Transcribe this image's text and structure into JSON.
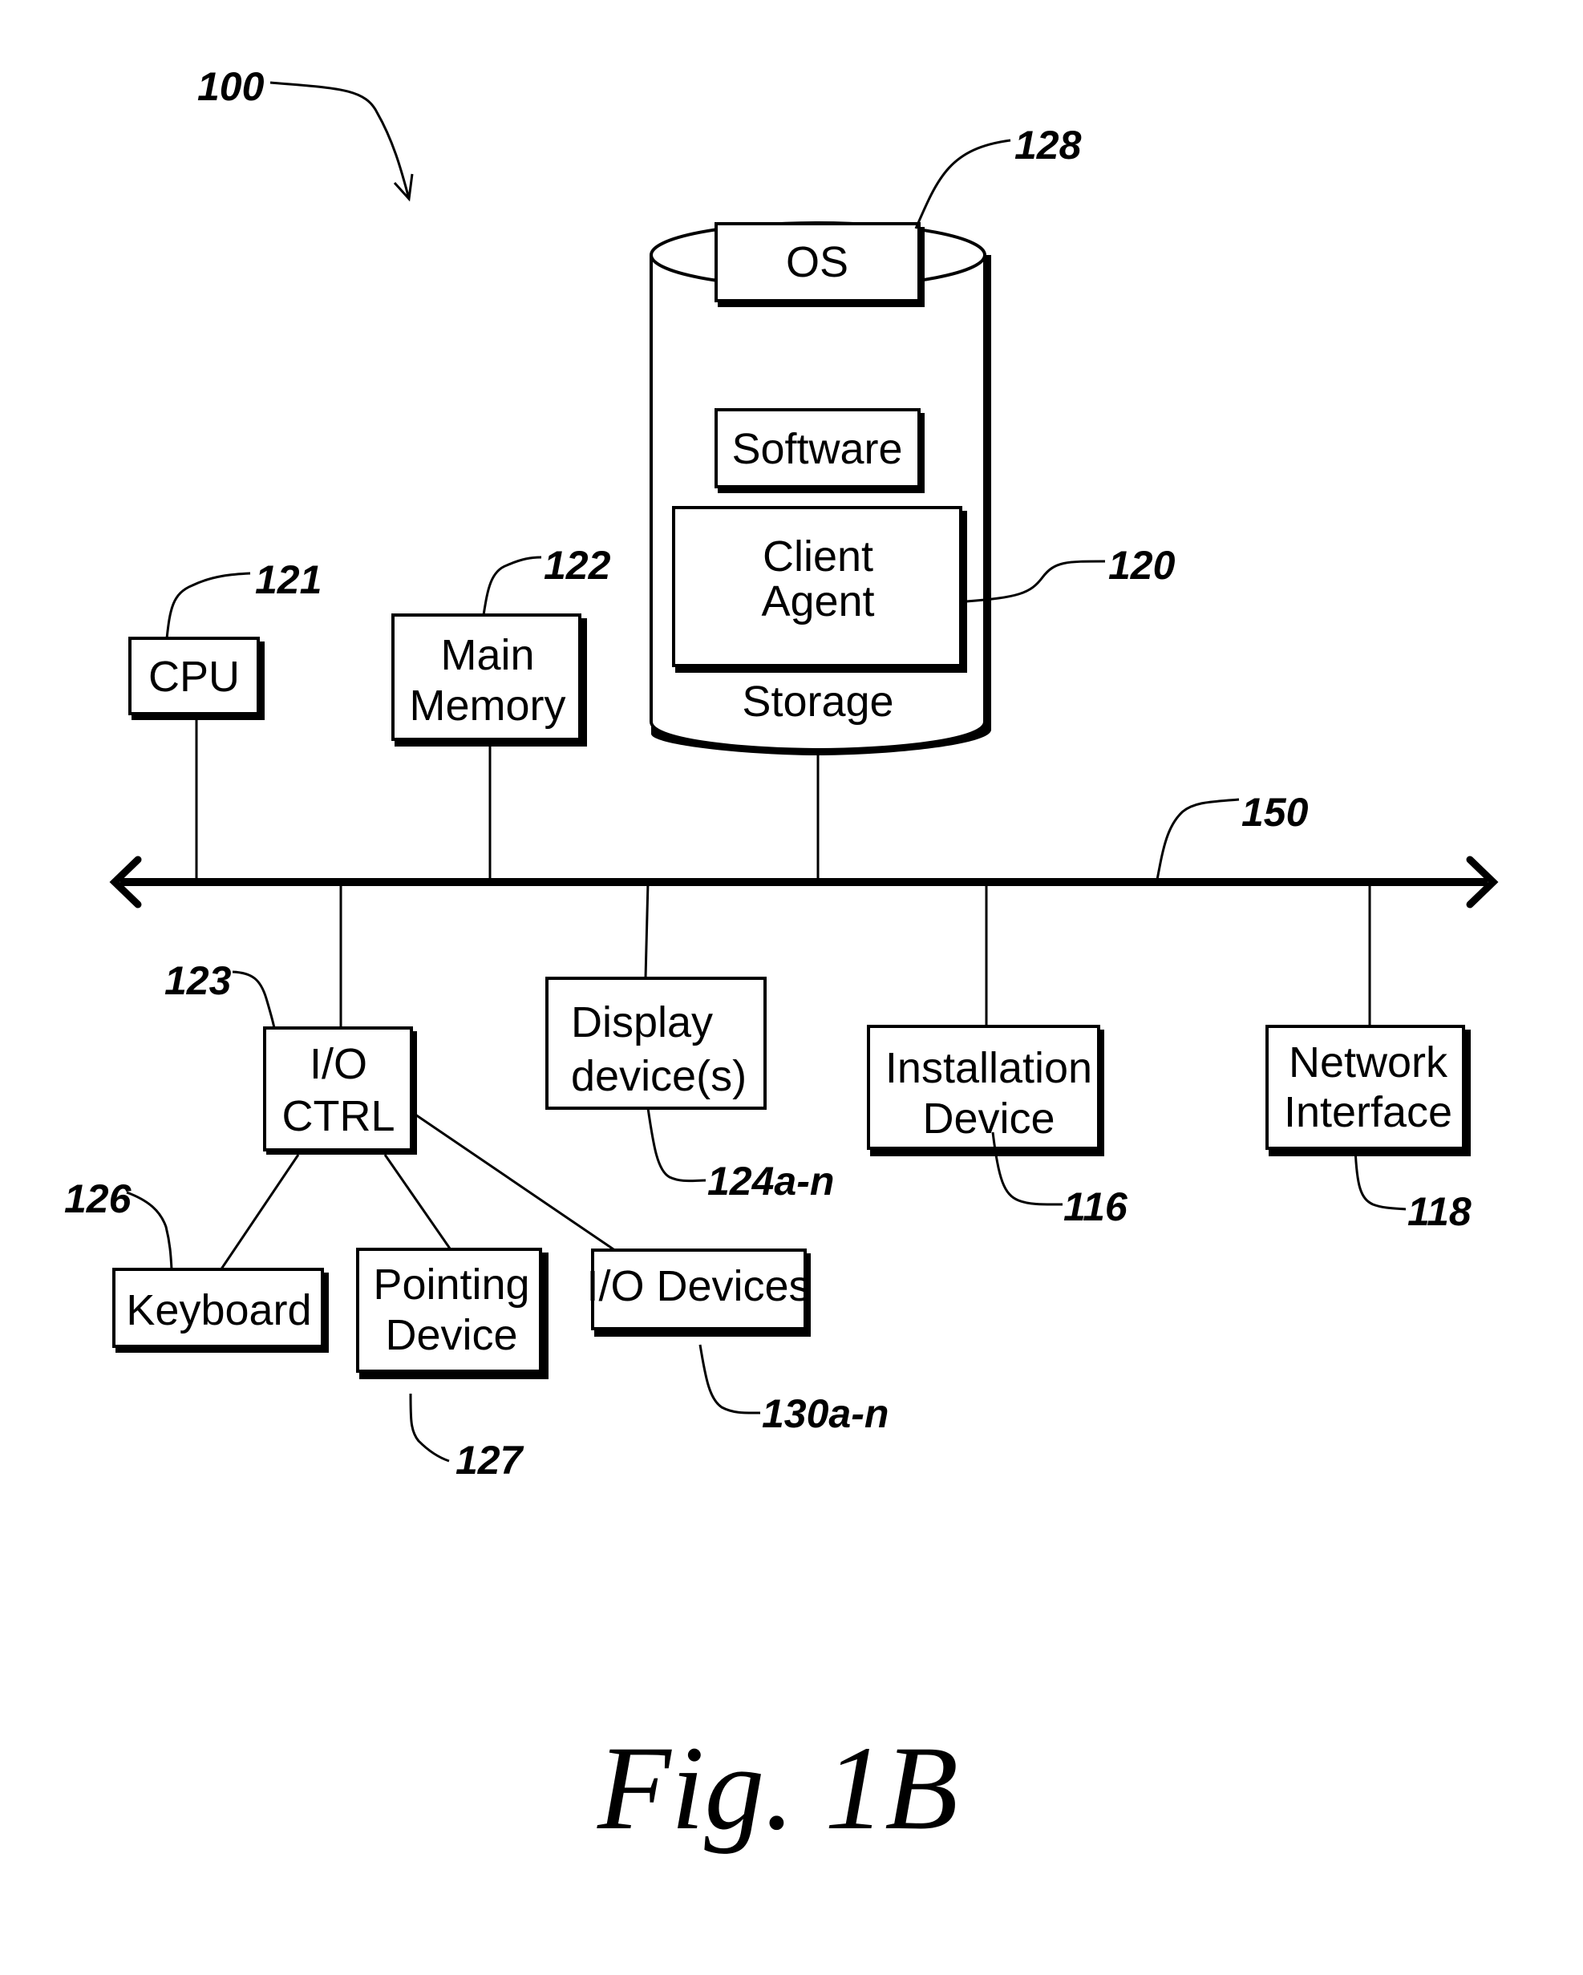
{
  "figure": {
    "caption": "Fig. 1B",
    "system_ref": "100"
  },
  "bus": {
    "ref": "150"
  },
  "storage": {
    "ref": "128",
    "label": "Storage",
    "contents": {
      "os": "OS",
      "software": "Software",
      "client_agent_line1": "Client",
      "client_agent_line2": "Agent",
      "client_agent_ref": "120"
    }
  },
  "components": {
    "cpu": {
      "label": "CPU",
      "ref": "121"
    },
    "main_memory": {
      "line1": "Main",
      "line2": "Memory",
      "ref": "122"
    },
    "io_ctrl": {
      "line1": "I/O",
      "line2": "CTRL",
      "ref": "123"
    },
    "display": {
      "line1": "Display",
      "line2": "device(s)",
      "ref": "124a-n"
    },
    "installation": {
      "line1": "Installation",
      "line2": "Device",
      "ref": "116"
    },
    "network": {
      "line1": "Network",
      "line2": "Interface",
      "ref": "118"
    },
    "keyboard": {
      "label": "Keyboard",
      "ref": "126"
    },
    "pointing": {
      "line1": "Pointing",
      "line2": "Device",
      "ref": "127"
    },
    "io_devices": {
      "label": "I/O Devices",
      "ref": "130a-n"
    }
  }
}
